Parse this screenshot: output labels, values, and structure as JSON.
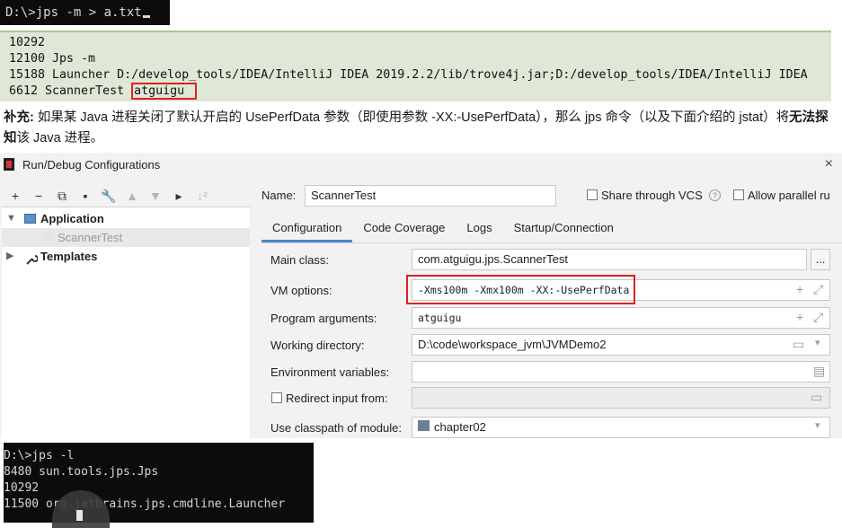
{
  "terminal_top": {
    "command": "D:\\>jps -m > a.txt"
  },
  "output_lines": [
    "10292",
    "12100 Jps -m",
    "15188 Launcher D:/develop_tools/IDEA/IntelliJ IDEA 2019.2.2/lib/trove4j.jar;D:/develop_tools/IDEA/IntelliJ IDEA",
    "6612 ScannerTest"
  ],
  "output_highlight": "atguigu",
  "note": {
    "lead": "补充:",
    "text1": " 如果某 Java 进程关闭了默认开启的 UsePerfData 参数（即使用参数 -XX:-UsePerfData），那么 jps 命令（以及下面介绍的 jstat）将",
    "bold": "无法探知",
    "text2": "该 Java 进程。"
  },
  "dialog": {
    "title": "Run/Debug Configurations",
    "close": "×",
    "toolbar": [
      "+",
      "−",
      "⧉",
      "▪",
      "🔧",
      "▲",
      "▼",
      "▸",
      "↓²"
    ],
    "tree": {
      "application": "Application",
      "config_item": "ScannerTest",
      "templates": "Templates"
    },
    "name_label": "Name:",
    "name_value": "ScannerTest",
    "share_label": "Share through VCS",
    "parallel_label": "Allow parallel ru",
    "tabs": [
      "Configuration",
      "Code Coverage",
      "Logs",
      "Startup/Connection"
    ],
    "form": {
      "main_class_label": "Main class:",
      "main_class_value": "com.atguigu.jps.ScannerTest",
      "browse": "...",
      "vm_label": "VM options:",
      "vm_value": "-Xms100m -Xmx100m -XX:-UsePerfData",
      "prog_label": "Program arguments:",
      "prog_value": "atguigu",
      "workdir_label": "Working directory:",
      "workdir_value": "D:\\code\\workspace_jvm\\JVMDemo2",
      "env_label": "Environment variables:",
      "env_value": "",
      "redirect_label": "Redirect input from:",
      "classpath_label": "Use classpath of module:",
      "classpath_value": "chapter02"
    }
  },
  "terminal_bottom": [
    "D:\\>jps -l",
    "8480 sun.tools.jps.Jps",
    "10292",
    "11500 org.jetbrains.jps.cmdline.Launcher"
  ],
  "colors": {
    "accent_tab": "#4a86c8",
    "highlight_box": "#e02020",
    "output_bg": "#dfe8d6"
  }
}
